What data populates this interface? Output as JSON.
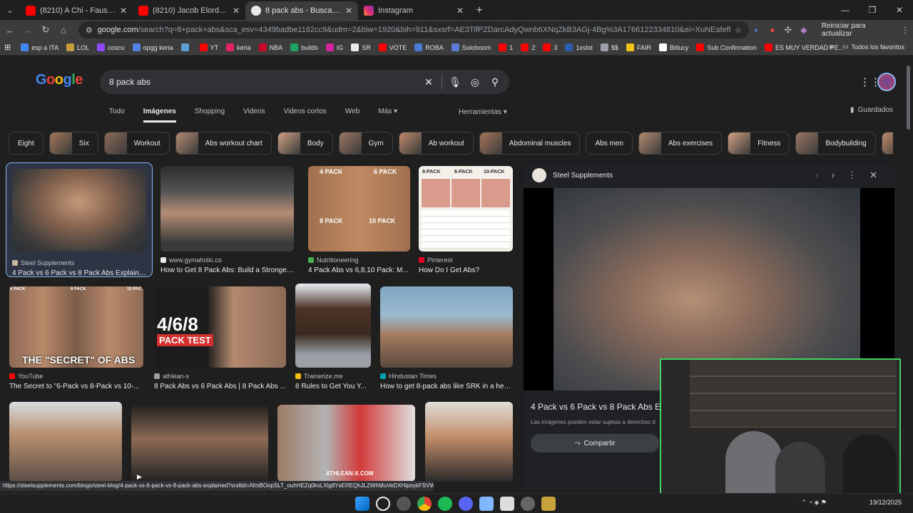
{
  "browser": {
    "tabs": [
      {
        "label": "(8210) A Chi - Fausto Leali - You",
        "favicon_color": "#ff0000"
      },
      {
        "label": "(8210) Jacob Elordi es ovacionad",
        "favicon_color": "#ff0000"
      },
      {
        "label": "8 pack abs - Buscar con Google",
        "favicon_color": "#e8eaed"
      },
      {
        "label": "Instagram",
        "favicon_color": "#d6249f"
      }
    ],
    "url_main": "google.com",
    "url_rest": "/search?q=8+pack+abs&sca_esv=4349badbe1162cc9&udm=2&biw=1920&bih=911&sxsrf=AE3TifPZDarcAdyQwnb6XNqZkB3AGj-4Bg%3A1766122334810&ei=XuNEafefMaPN5OUP082VyAs&ved=0ahU...",
    "update_label": "Reiniciar para actualizar"
  },
  "bookmarks": [
    {
      "label": "esp a ITA",
      "color": "#4285f4"
    },
    {
      "label": "LOL",
      "color": "#c89b3c"
    },
    {
      "label": "coscu",
      "color": "#9146ff"
    },
    {
      "label": "opgg keria",
      "color": "#5383e8"
    },
    {
      "label": "",
      "color": "#5c9fd6"
    },
    {
      "label": "YT",
      "color": "#ff0000"
    },
    {
      "label": "keria",
      "color": "#e0245e"
    },
    {
      "label": "NBA",
      "color": "#c9082a"
    },
    {
      "label": "builds",
      "color": "#1fa463"
    },
    {
      "label": "IG",
      "color": "#d6249f"
    },
    {
      "label": "SR",
      "color": "#e8eaed"
    },
    {
      "label": "VOTE",
      "color": "#ff0000"
    },
    {
      "label": "ROBA",
      "color": "#4a7bd0"
    },
    {
      "label": "Soloboom",
      "color": "#5b7bd5"
    },
    {
      "label": "1",
      "color": "#ff0000"
    },
    {
      "label": "2",
      "color": "#ff0000"
    },
    {
      "label": "3",
      "color": "#ff0000"
    },
    {
      "label": "1xslot",
      "color": "#2b5cab"
    },
    {
      "label": "$$",
      "color": "#9aa0a6"
    },
    {
      "label": "FAIR",
      "color": "#f5c518"
    },
    {
      "label": "Bitlucy",
      "color": "#ffffff"
    },
    {
      "label": "Sub Confirmation",
      "color": "#ff0000"
    },
    {
      "label": "ES MUY VERDAD PE...",
      "color": "#ff0000"
    }
  ],
  "bookmarks_all": "Todos los favoritos",
  "search": {
    "query": "8 pack abs",
    "logo": "Google"
  },
  "nav": {
    "tabs": [
      "Todo",
      "Imágenes",
      "Shopping",
      "Videos",
      "Videos cortos",
      "Web",
      "Más ▾"
    ],
    "tools": "Herramientas ▾",
    "saved": "Guardados"
  },
  "chips": [
    {
      "label": "Eight",
      "thumb": false
    },
    {
      "label": "Six",
      "thumb": true
    },
    {
      "label": "Workout",
      "thumb": true
    },
    {
      "label": "Abs workout chart",
      "thumb": true
    },
    {
      "label": "Body",
      "thumb": true
    },
    {
      "label": "Gym",
      "thumb": true
    },
    {
      "label": "Ab workout",
      "thumb": true
    },
    {
      "label": "Abdominal muscles",
      "thumb": true
    },
    {
      "label": "Abs men",
      "thumb": false
    },
    {
      "label": "Abs exercises",
      "thumb": true
    },
    {
      "label": "Fitness",
      "thumb": true
    },
    {
      "label": "Bodybuilding",
      "thumb": true
    },
    {
      "label": "Abs genetic",
      "thumb": true
    }
  ],
  "results": [
    {
      "source": "Steel Supplements",
      "title": "4 Pack vs 6 Pack vs 8 Pack Abs Explaine...",
      "fav": "#c9b99a"
    },
    {
      "source": "www.gymaholic.co",
      "title": "How to Get 8 Pack Abs: Build a Stronger, ...",
      "fav": "#e8eaed"
    },
    {
      "source": "Nutritioneering",
      "title": "4 Pack Abs vs 6,8,10 Pack: M...",
      "fav": "#4caf50"
    },
    {
      "source": "Pinterest",
      "title": "How Do I Get Abs?",
      "fav": "#e60023"
    },
    {
      "source": "YouTube",
      "title": "The Secret to \"6-Pack vs 8-Pack vs 10-...",
      "fav": "#ff0000"
    },
    {
      "source": "athlean-x",
      "title": "8 Pack Abs vs 6 Pack Abs | 8 Pack Abs ...",
      "fav": "#9aa0a6"
    },
    {
      "source": "Trainerize.me",
      "title": "8 Rules to Get You Y...",
      "fav": "#f4c20d"
    },
    {
      "source": "Hindustan Times",
      "title": "How to get 8-pack abs like SRK in a hea...",
      "fav": "#00a0b0"
    }
  ],
  "image_text": {
    "r1c3_top_left": "4 PACK",
    "r1c3_top_right": "6 PACK",
    "r1c3_bottom_left": "8 PACK",
    "r1c3_bottom_right": "10 PACK",
    "r1c4_headers": [
      "8-PACK",
      "6-PACK",
      "10-PACK"
    ],
    "r2c1_labels": [
      "6 PACK",
      "8 PACK",
      "10 PAC"
    ],
    "r2c1_caption": "THE \"SECRET\" OF ABS",
    "r2c2_big": "4/6/8",
    "r2c2_sub": "PACK TEST",
    "r3c3_watermark": "ATHLEAN-X.COM"
  },
  "preview": {
    "source": "Steel Supplements",
    "title": "4 Pack vs 6 Pack vs 8 Pack Abs Ex",
    "note": "Las imágenes pueden estar sujetas a derechos d",
    "share": "Compartir"
  },
  "statusbar": "https://steelsupplements.com/blogs/steel-blog/4-pack-vs-6-pack-vs-8-pack-abs-explained?srsltid=AfmBOopSLT_ouhHEZq0ksLXlg8YsEREQhJLZWhMuVeDXHipoykFSVWQI",
  "taskbar": {
    "date": "19/12/2025"
  }
}
